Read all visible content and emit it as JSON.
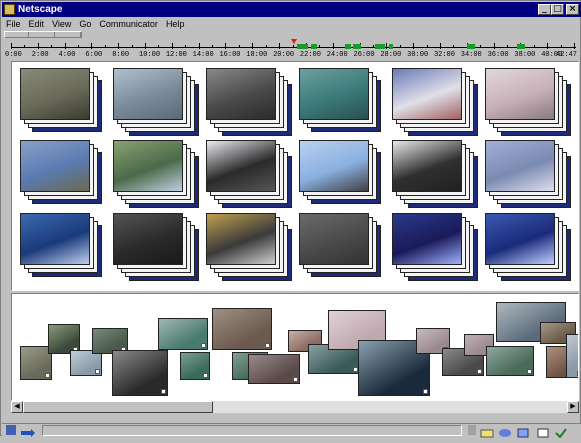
{
  "window": {
    "title": "Netscape"
  },
  "menu": [
    "File",
    "Edit",
    "View",
    "Go",
    "Communicator",
    "Help"
  ],
  "timeline": {
    "ticks": [
      "0:00",
      "2:00",
      "4:00",
      "6:00",
      "8:00",
      "10:00",
      "12:00",
      "14:00",
      "16:00",
      "18:00",
      "20:00",
      "22:00",
      "24:00",
      "26:00",
      "28:00",
      "30:00",
      "32:00",
      "34:00",
      "36:00",
      "38:00",
      "40:00",
      "42:47"
    ]
  },
  "status_icons": [
    "netscape-doc-icon",
    "security-icon",
    "component-icon",
    "mail-icon",
    "discussion-icon",
    "composer-icon",
    "bookmark-check-icon"
  ],
  "colors": {
    "window_bg": "#c0c0c0",
    "title_bg": "#000080",
    "stack_back": "#1c2a78",
    "marker": "#e02000",
    "segment": "#1a9a28"
  }
}
